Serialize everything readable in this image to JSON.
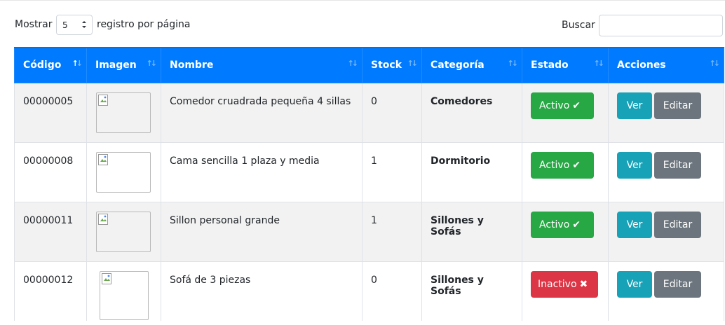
{
  "controls": {
    "show_label": "Mostrar",
    "page_size": "5",
    "show_after": "registro por página",
    "search_label": "Buscar",
    "search_value": ""
  },
  "table": {
    "headers": [
      "Código",
      "Imagen",
      "Nombre",
      "Stock",
      "Categoría",
      "Estado",
      "Acciones"
    ],
    "sorted_column": "Código",
    "rows": [
      {
        "codigo": "00000005",
        "nombre": "Comedor cruadrada pequeña 4 sillas",
        "stock": "0",
        "categoria": "Comedores",
        "estado": "Activo",
        "estado_icon": "check-icon",
        "estado_color": "#28a745",
        "ver": "Ver",
        "editar": "Editar"
      },
      {
        "codigo": "00000008",
        "nombre": "Cama sencilla 1 plaza y media",
        "stock": "1",
        "categoria": "Dormitorio",
        "estado": "Activo",
        "estado_icon": "check-icon",
        "estado_color": "#28a745",
        "ver": "Ver",
        "editar": "Editar"
      },
      {
        "codigo": "00000011",
        "nombre": "Sillon personal grande",
        "stock": "1",
        "categoria": "Sillones y Sofás",
        "estado": "Activo",
        "estado_icon": "check-icon",
        "estado_color": "#28a745",
        "ver": "Ver",
        "editar": "Editar"
      },
      {
        "codigo": "00000012",
        "nombre": "Sofá de 3 piezas",
        "stock": "0",
        "categoria": "Sillones y Sofás",
        "estado": "Inactivo",
        "estado_icon": "x-icon",
        "estado_color": "#dc3545",
        "ver": "Ver",
        "editar": "Editar"
      }
    ]
  },
  "colors": {
    "header_bg": "#007bff",
    "active": "#28a745",
    "inactive": "#dc3545",
    "view": "#17a2b8",
    "edit": "#6c757d",
    "stripe": "#f2f2f2"
  }
}
